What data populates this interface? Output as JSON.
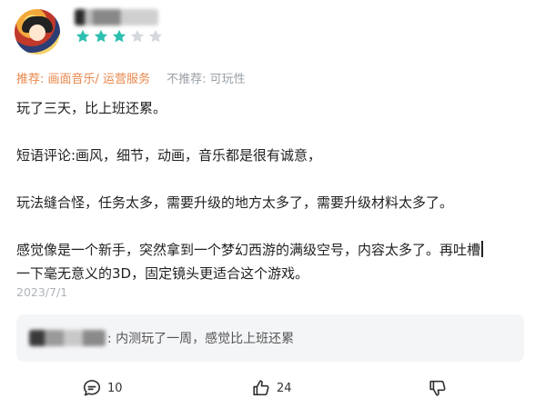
{
  "user": {
    "rating_stars": 3,
    "max_stars": 5
  },
  "tags": {
    "recommend": "推荐: 画面音乐/ 运营服务",
    "not_recommend": "不推荐: 可玩性"
  },
  "review": {
    "p1": "玩了三天，比上班还累。",
    "p2": "短语评论:画风，细节，动画，音乐都是很有诚意，",
    "p3": "玩法缝合怪，任务太多，需要升级的地方太多了，需要升级材料太多了。",
    "p4_line1": "感觉像是一个新手，突然拿到一个梦幻西游的满级空号，内容太多了。再吐槽",
    "p4_line2": "一下毫无意义的3D，固定镜头更适合这个游戏。"
  },
  "date": "2023/7/1",
  "reply": {
    "text": ": 内测玩了一周，感觉比上班还累"
  },
  "actions": {
    "comment_count": "10",
    "like_count": "24"
  },
  "colors": {
    "star_filled": "#2bbfb0",
    "star_empty": "#d5d8dc",
    "recommend": "#e8874b",
    "muted": "#9aa0a6"
  }
}
